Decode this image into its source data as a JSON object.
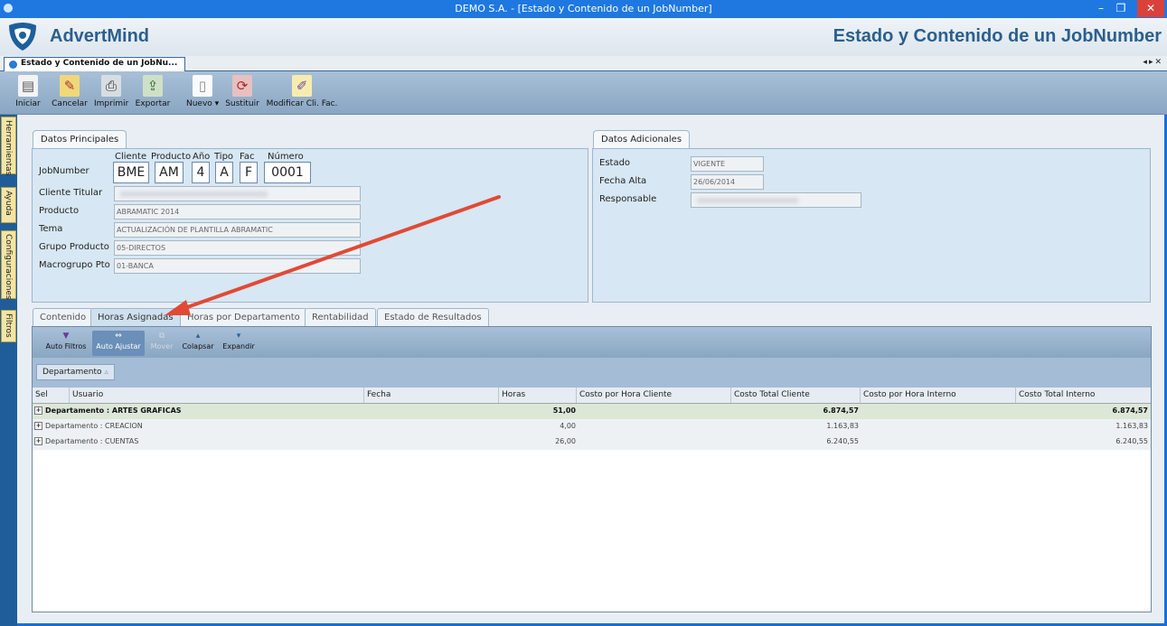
{
  "window": {
    "title": "DEMO S.A. - [Estado y Contenido de un JobNumber]"
  },
  "header": {
    "brand": "AdvertMind",
    "screen_title": "Estado y Contenido de un JobNumber"
  },
  "doc_tab": {
    "label": "Estado y Contenido de un JobNu..."
  },
  "toolbar": [
    {
      "label": "Iniciar",
      "icon": "start-icon"
    },
    {
      "label": "Cancelar",
      "icon": "cancel-icon"
    },
    {
      "label": "Imprimir",
      "icon": "printer-icon"
    },
    {
      "label": "Exportar",
      "icon": "export-icon"
    },
    {
      "label": "Nuevo ▾",
      "icon": "new-document-icon"
    },
    {
      "label": "Sustituir",
      "icon": "replace-icon"
    },
    {
      "label": "Modificar Cli. Fac.",
      "icon": "edit-icon"
    }
  ],
  "side_rail": [
    "Herramientas",
    "Ayuda",
    "Configuraciones",
    "Filtros"
  ],
  "datos_principales": {
    "title": "Datos Principales",
    "jobnumber_label": "JobNumber",
    "job_headers": [
      "Cliente",
      "Producto",
      "Año",
      "Tipo",
      "Fac",
      "Número"
    ],
    "job_values": [
      "BME",
      "AM",
      "4",
      "A",
      "F",
      "0001"
    ],
    "fields": [
      {
        "label": "Cliente Titular",
        "value": "",
        "blurred": true
      },
      {
        "label": "Producto",
        "value": "ABRAMATIC 2014"
      },
      {
        "label": "Tema",
        "value": "ACTUALIZACIÓN DE PLANTILLA ABRAMATIC"
      },
      {
        "label": "Grupo Producto",
        "value": "05-DIRECTOS"
      },
      {
        "label": "Macrogrupo Pto",
        "value": "01-BANCA"
      }
    ]
  },
  "datos_adicionales": {
    "title": "Datos Adicionales",
    "fields": [
      {
        "label": "Estado",
        "value": "VIGENTE"
      },
      {
        "label": "Fecha Alta",
        "value": "26/06/2014"
      },
      {
        "label": "Responsable",
        "value": "",
        "blurred": true
      }
    ]
  },
  "lower_tabs": [
    "Contenido",
    "Horas Asignadas",
    "Horas por Departamento",
    "Rentabilidad",
    "Estado de Resultados"
  ],
  "active_lower_tab": "Horas Asignadas",
  "subtoolbar": [
    {
      "label": "Auto Filtros",
      "state": "normal"
    },
    {
      "label": "Auto Ajustar",
      "state": "active"
    },
    {
      "label": "Mover",
      "state": "disabled"
    },
    {
      "label": "Colapsar",
      "state": "normal"
    },
    {
      "label": "Expandir",
      "state": "normal"
    }
  ],
  "group_by": "Departamento",
  "grid": {
    "columns": [
      "Sel",
      "Usuario",
      "Fecha",
      "Horas",
      "Costo por Hora Cliente",
      "Costo Total Cliente",
      "Costo por Hora Interno",
      "Costo Total Interno"
    ],
    "rows": [
      {
        "group": "Departamento : ARTES GRAFICAS",
        "horas": "51,00",
        "costo_total_cliente": "6.874,57",
        "costo_total_interno": "6.874,57"
      },
      {
        "group": "Departamento : CREACION",
        "horas": "4,00",
        "costo_total_cliente": "1.163,83",
        "costo_total_interno": "1.163,83"
      },
      {
        "group": "Departamento : CUENTAS",
        "horas": "26,00",
        "costo_total_cliente": "6.240,55",
        "costo_total_interno": "6.240,55"
      }
    ]
  },
  "colors": {
    "title_bar": "#1e78e0",
    "brand_text": "#2b5f8e",
    "panel": "#d7e7f3",
    "close_button": "#d9423a",
    "annotation_arrow": "#e04a35"
  }
}
